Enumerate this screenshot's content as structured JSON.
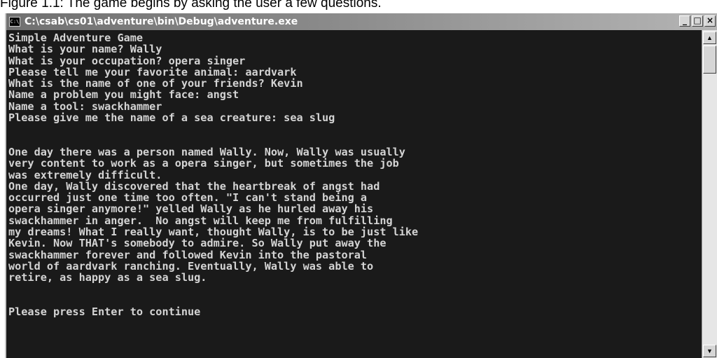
{
  "caption": "Figure 1.1: The game begins by asking the user a few questions.",
  "window": {
    "title": "C:\\csab\\cs01\\adventure\\bin\\Debug\\adventure.exe",
    "icon": "console-app-icon",
    "icon_glyph": "C:\\",
    "controls": {
      "minimize": "_",
      "maximize": "□",
      "close": "×"
    }
  },
  "scrollbar": {
    "up_arrow": "▲",
    "down_arrow": "▼"
  },
  "console": {
    "lines": [
      "Simple Adventure Game",
      "What is your name? Wally",
      "What is your occupation? opera singer",
      "Please tell me your favorite animal: aardvark",
      "What is the name of one of your friends? Kevin",
      "Name a problem you might face: angst",
      "Name a tool: swackhammer",
      "Please give me the name of a sea creature: sea slug",
      "",
      "",
      "One day there was a person named Wally. Now, Wally was usually",
      "very content to work as a opera singer, but sometimes the job",
      "was extremely difficult.",
      "One day, Wally discovered that the heartbreak of angst had",
      "occurred just one time too often. \"I can't stand being a",
      "opera singer anymore!\" yelled Wally as he hurled away his",
      "swackhammer in anger.  No angst will keep me from fulfilling",
      "my dreams! What I really want, thought Wally, is to be just like",
      "Kevin. Now THAT's somebody to admire. So Wally put away the",
      "swackhammer forever and followed Kevin into the pastoral",
      "world of aardvark ranching. Eventually, Wally was able to",
      "retire, as happy as a sea slug.",
      "",
      "",
      "Please press Enter to continue"
    ]
  }
}
